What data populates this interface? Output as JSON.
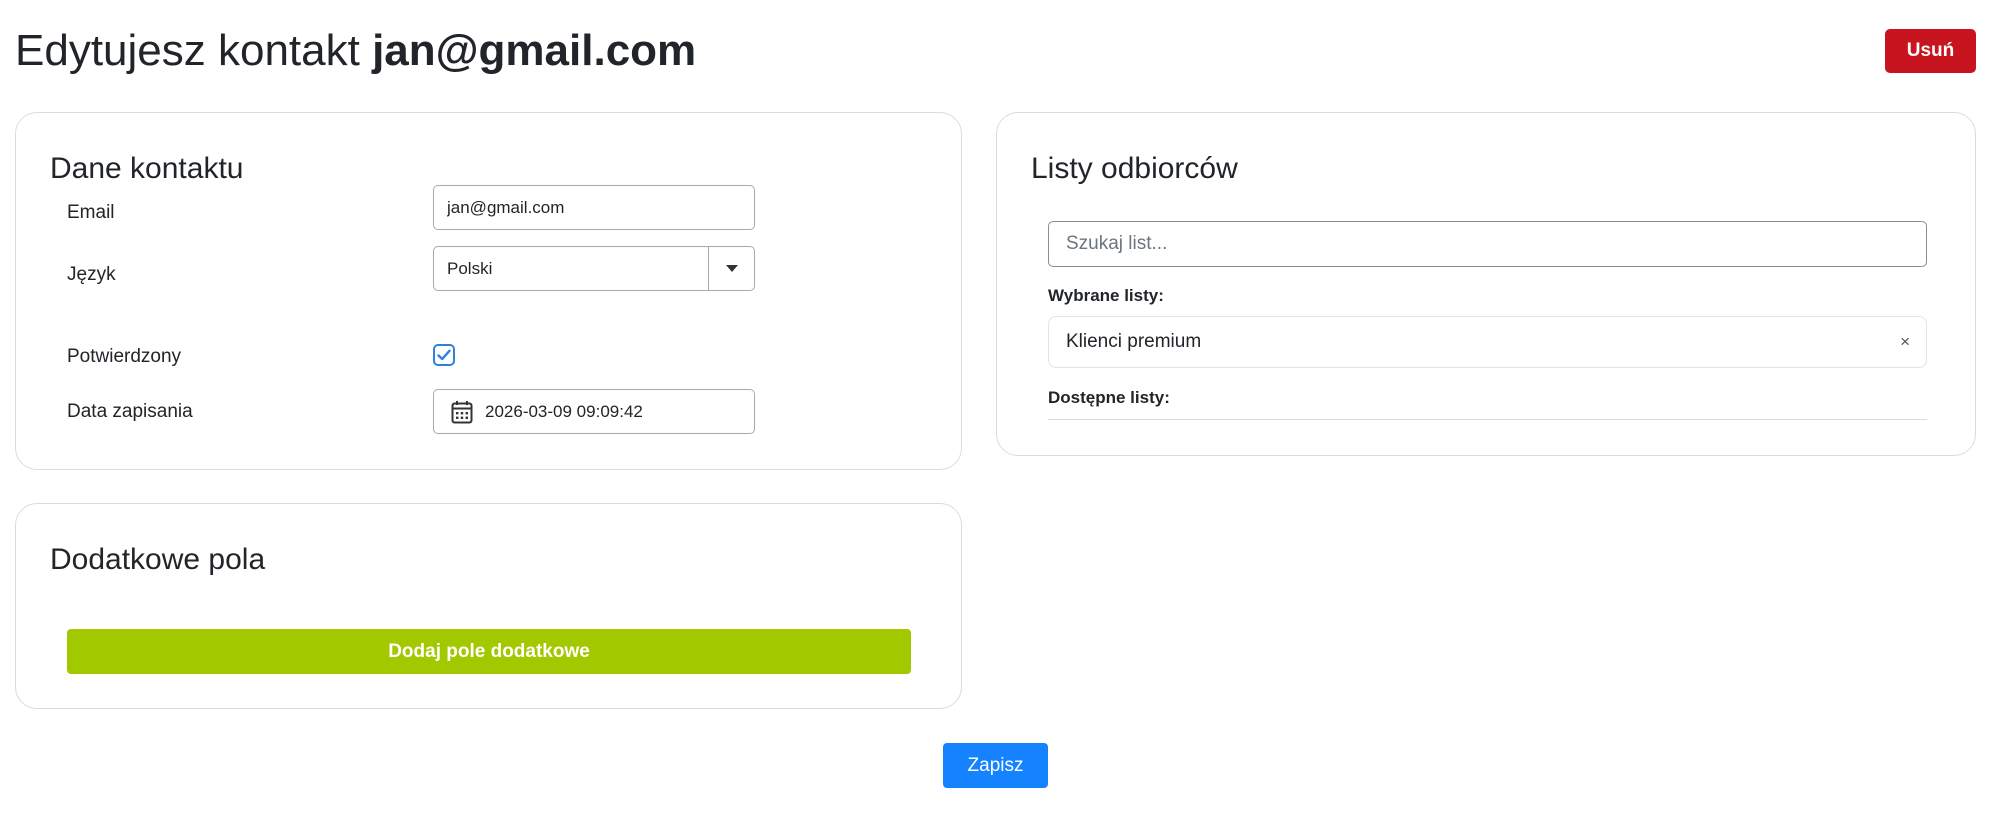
{
  "header": {
    "title_prefix": "Edytujesz kontakt ",
    "title_email": "jan@gmail.com",
    "delete_label": "Usuń"
  },
  "contact_card": {
    "title": "Dane kontaktu",
    "email": {
      "label": "Email",
      "value": "jan@gmail.com"
    },
    "language": {
      "label": "Język",
      "value": "Polski"
    },
    "confirmed": {
      "label": "Potwierdzony",
      "checked": true
    },
    "saved_date": {
      "label": "Data zapisania",
      "value": "2026-03-09 09:09:42"
    }
  },
  "lists_card": {
    "title": "Listy odbiorców",
    "search_placeholder": "Szukaj list...",
    "selected_label": "Wybrane listy:",
    "selected": [
      "Klienci premium"
    ],
    "remove_symbol": "×",
    "available_label": "Dostępne listy:"
  },
  "extra_card": {
    "title": "Dodatkowe pola",
    "add_label": "Dodaj pole dodatkowe"
  },
  "footer": {
    "save_label": "Zapisz"
  },
  "colors": {
    "danger": "#c8141e",
    "success": "#a2c800",
    "primary": "#1583ff",
    "checkbox": "#2f7fe0"
  },
  "icons": [
    "caret-down-icon",
    "check-icon",
    "calendar-icon",
    "close-icon"
  ]
}
